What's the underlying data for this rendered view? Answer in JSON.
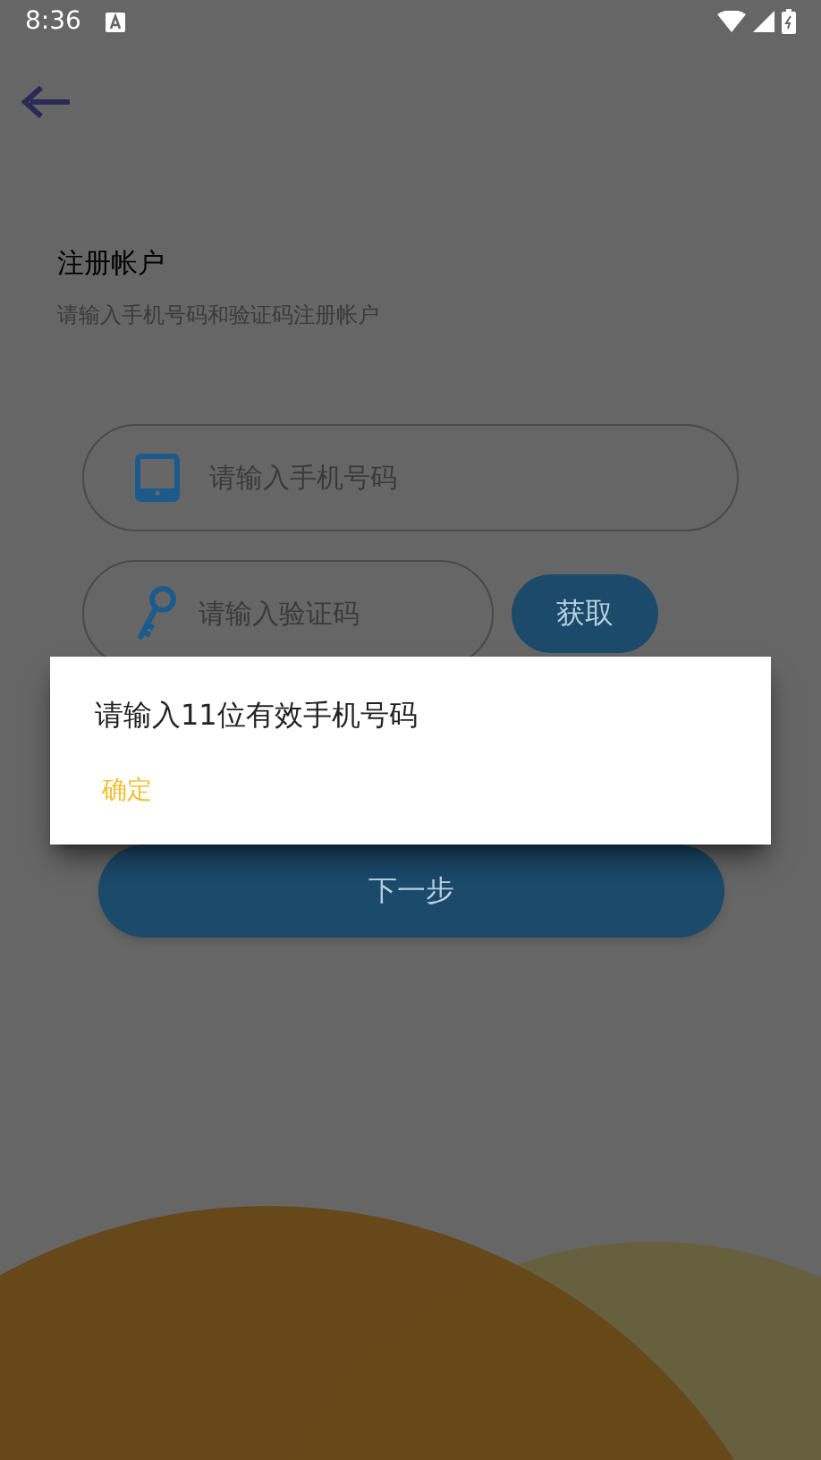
{
  "status_bar": {
    "time": "8:36"
  },
  "header": {
    "title": "注册帐户",
    "subtitle": "请输入手机号码和验证码注册帐户"
  },
  "phone_field": {
    "placeholder": "请输入手机号码"
  },
  "code_field": {
    "placeholder": "请输入验证码"
  },
  "get_code_button": {
    "label": "获取"
  },
  "next_button": {
    "label": "下一步"
  },
  "dialog": {
    "message": "请输入11位有效手机号码",
    "buttons": [
      "确定"
    ]
  }
}
